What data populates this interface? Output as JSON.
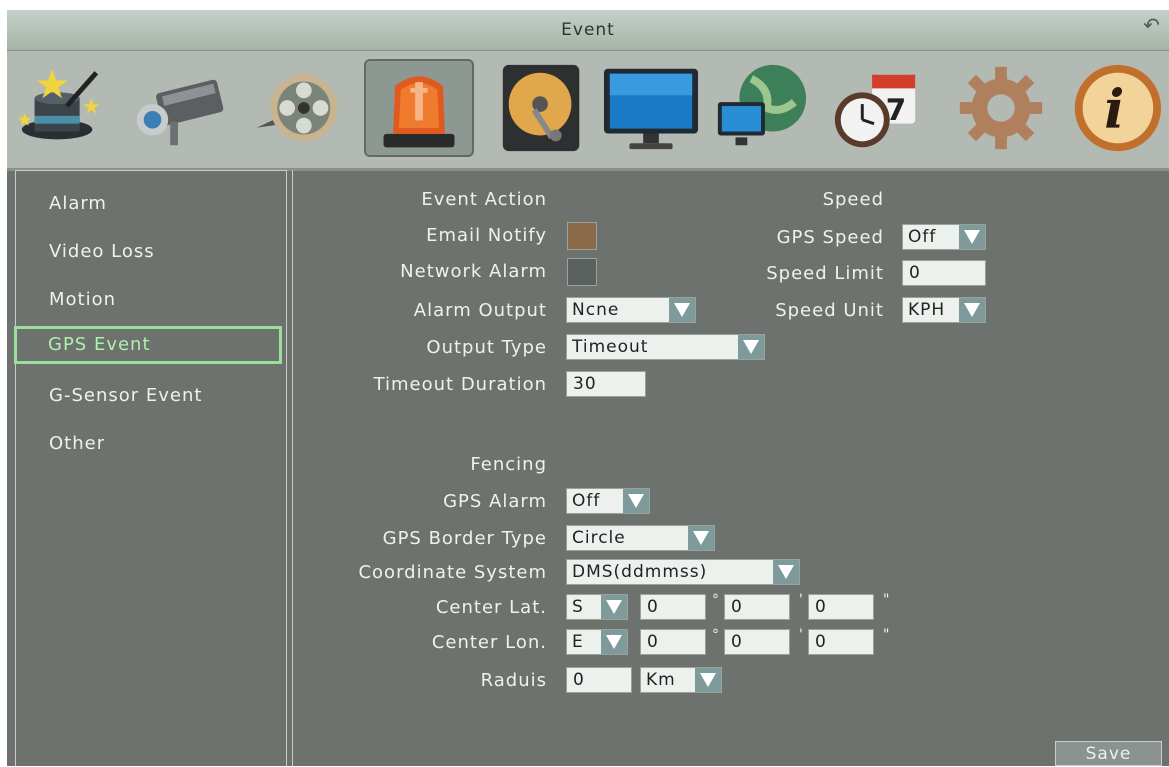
{
  "window": {
    "title": "Event",
    "back_icon": "back-arrow-icon"
  },
  "toolbar": {
    "icons": [
      "magic-wand-hat-icon",
      "camera-icon",
      "film-reel-icon",
      "alarm-light-icon",
      "hard-drive-icon",
      "monitor-icon",
      "network-globe-icon",
      "schedule-clock-calendar-icon",
      "gear-icon",
      "info-icon"
    ],
    "active_index": 3,
    "calendar_day": "7"
  },
  "sidebar": {
    "items": [
      {
        "label": "Alarm"
      },
      {
        "label": "Video Loss"
      },
      {
        "label": "Motion"
      },
      {
        "label": "GPS Event"
      },
      {
        "label": "G-Sensor Event"
      },
      {
        "label": "Other"
      }
    ],
    "active_index": 3
  },
  "event_action": {
    "heading": "Event Action",
    "email_notify": {
      "label": "Email Notify",
      "checked": true,
      "color": "#8a6a48"
    },
    "network_alarm": {
      "label": "Network Alarm",
      "checked": false,
      "color": "#5a615e"
    },
    "alarm_output": {
      "label": "Alarm Output",
      "value": "Ncne"
    },
    "output_type": {
      "label": "Output Type",
      "value": "Timeout"
    },
    "timeout_duration": {
      "label": "Timeout Duration",
      "value": "30"
    }
  },
  "speed": {
    "heading": "Speed",
    "gps_speed": {
      "label": "GPS Speed",
      "value": "Off"
    },
    "speed_limit": {
      "label": "Speed Limit",
      "value": "0"
    },
    "speed_unit": {
      "label": "Speed Unit",
      "value": "KPH"
    }
  },
  "fencing": {
    "heading": "Fencing",
    "gps_alarm": {
      "label": "GPS Alarm",
      "value": "Off"
    },
    "border_type": {
      "label": "GPS Border Type",
      "value": "Circle"
    },
    "coordinate_system": {
      "label": "Coordinate System",
      "value": "DMS(ddmmss)"
    },
    "center_lat": {
      "label": "Center Lat.",
      "hemisphere": "S",
      "deg": "0",
      "min": "0",
      "sec": "0"
    },
    "center_lon": {
      "label": "Center Lon.",
      "hemisphere": "E",
      "deg": "0",
      "min": "0",
      "sec": "0"
    },
    "radius": {
      "label": "Raduis",
      "value": "0",
      "unit": "Km"
    },
    "deg_symbol": "°",
    "min_symbol": "'",
    "sec_symbol": "\""
  },
  "buttons": {
    "save": "Save"
  },
  "colors": {
    "background": "#6e726e",
    "titlebar": "#b8c6bc",
    "toolbar": "#b3b9b3",
    "active_item": "#9ae09a",
    "dropdown_arrow": "#7f9a9a"
  }
}
